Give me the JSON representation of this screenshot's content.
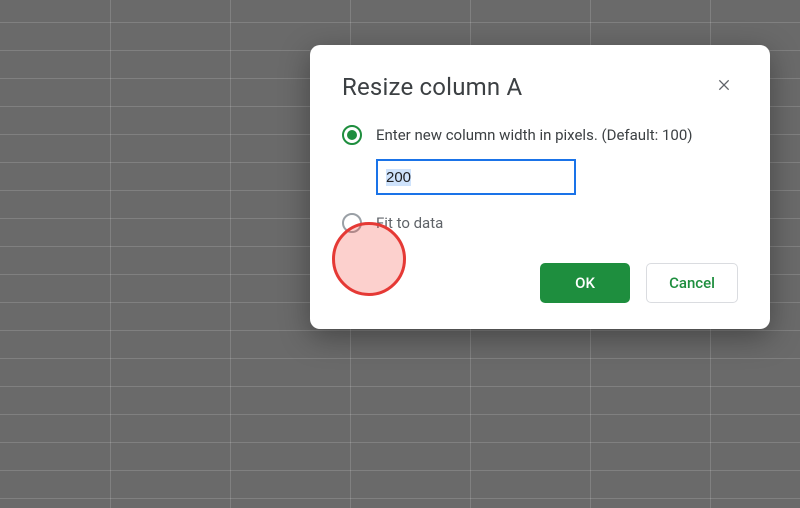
{
  "dialog": {
    "title": "Resize column A",
    "option_enter_width_label": "Enter new column width in pixels. (Default: 100)",
    "width_value": "200",
    "option_fit_label": "Fit to data",
    "ok_label": "OK",
    "cancel_label": "Cancel"
  }
}
